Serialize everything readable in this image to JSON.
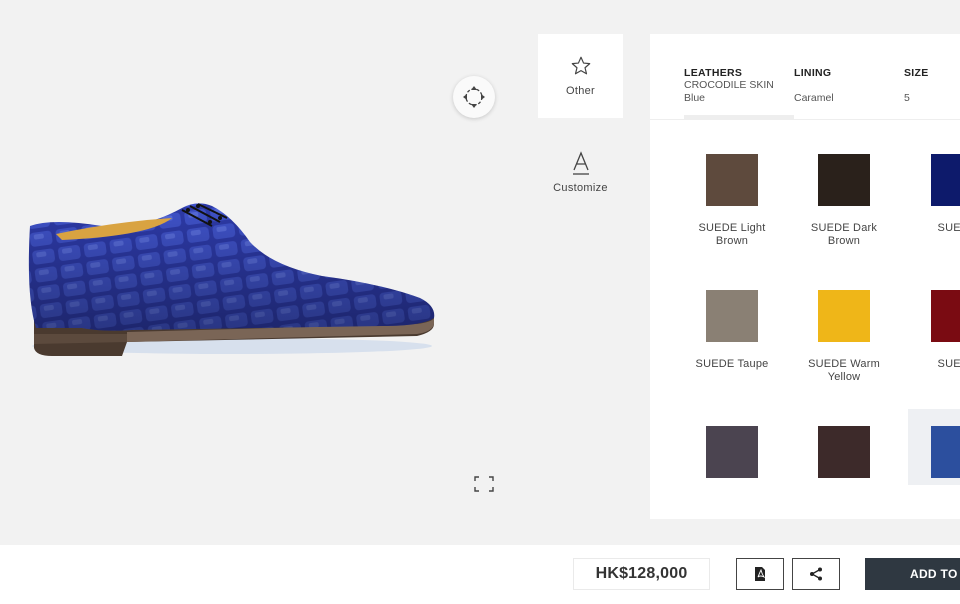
{
  "viewer": {
    "rotate_icon": "rotate-360-icon",
    "fullscreen_icon": "fullscreen-icon",
    "product_image": "blue-crocodile-oxford-shoe"
  },
  "side_menu": {
    "other_label": "Other",
    "other_icon": "star-icon",
    "customize_label": "Customize",
    "customize_icon": "letter-a-icon"
  },
  "tabs": [
    {
      "title": "LEATHERS",
      "lines": [
        "CROCODILE SKIN",
        "Blue"
      ]
    },
    {
      "title": "LINING",
      "lines": [
        "",
        "Caramel"
      ]
    },
    {
      "title": "SIZE",
      "lines": [
        "",
        "5"
      ]
    }
  ],
  "swatches": [
    {
      "label_1": "SUEDE Light",
      "label_2": "Brown",
      "color": "#5e4a3d"
    },
    {
      "label_1": "SUEDE Dark",
      "label_2": "Brown",
      "color": "#2a211b"
    },
    {
      "label_1": "SUEDE",
      "label_2": "",
      "color": "#0d1a6b"
    },
    {
      "label_1": "SUEDE Taupe",
      "label_2": "",
      "color": "#8a8074"
    },
    {
      "label_1": "SUEDE Warm",
      "label_2": "Yellow",
      "color": "#efb618"
    },
    {
      "label_1": "SUEDE",
      "label_2": "",
      "color": "#7a0b12"
    },
    {
      "label_1": "",
      "label_2": "",
      "color": "#4b4450"
    },
    {
      "label_1": "",
      "label_2": "",
      "color": "#3d2a2a"
    },
    {
      "label_1": "",
      "label_2": "",
      "color": "#2c4f9e"
    }
  ],
  "footer": {
    "price": "HK$128,000",
    "pdf_icon": "pdf-icon",
    "share_icon": "share-icon",
    "add_label": "ADD TO C"
  }
}
